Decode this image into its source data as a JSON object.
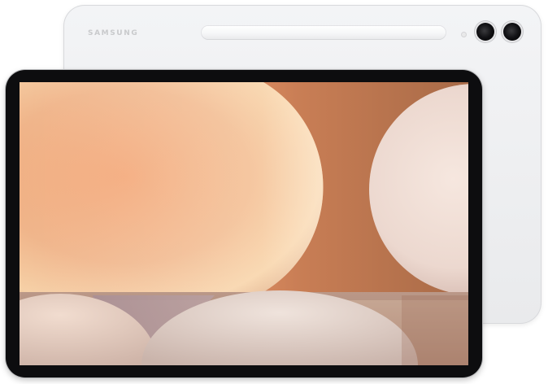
{
  "device": {
    "brand_text": "SAMSUNG",
    "back_color": "#eceef0",
    "bezel_color": "#0d0d0f"
  },
  "wallpaper": {
    "palette": [
      "#8fa6c2",
      "#e9966c",
      "#f6c49a",
      "#b87956",
      "#f1ded4",
      "#d7c7c2"
    ]
  }
}
